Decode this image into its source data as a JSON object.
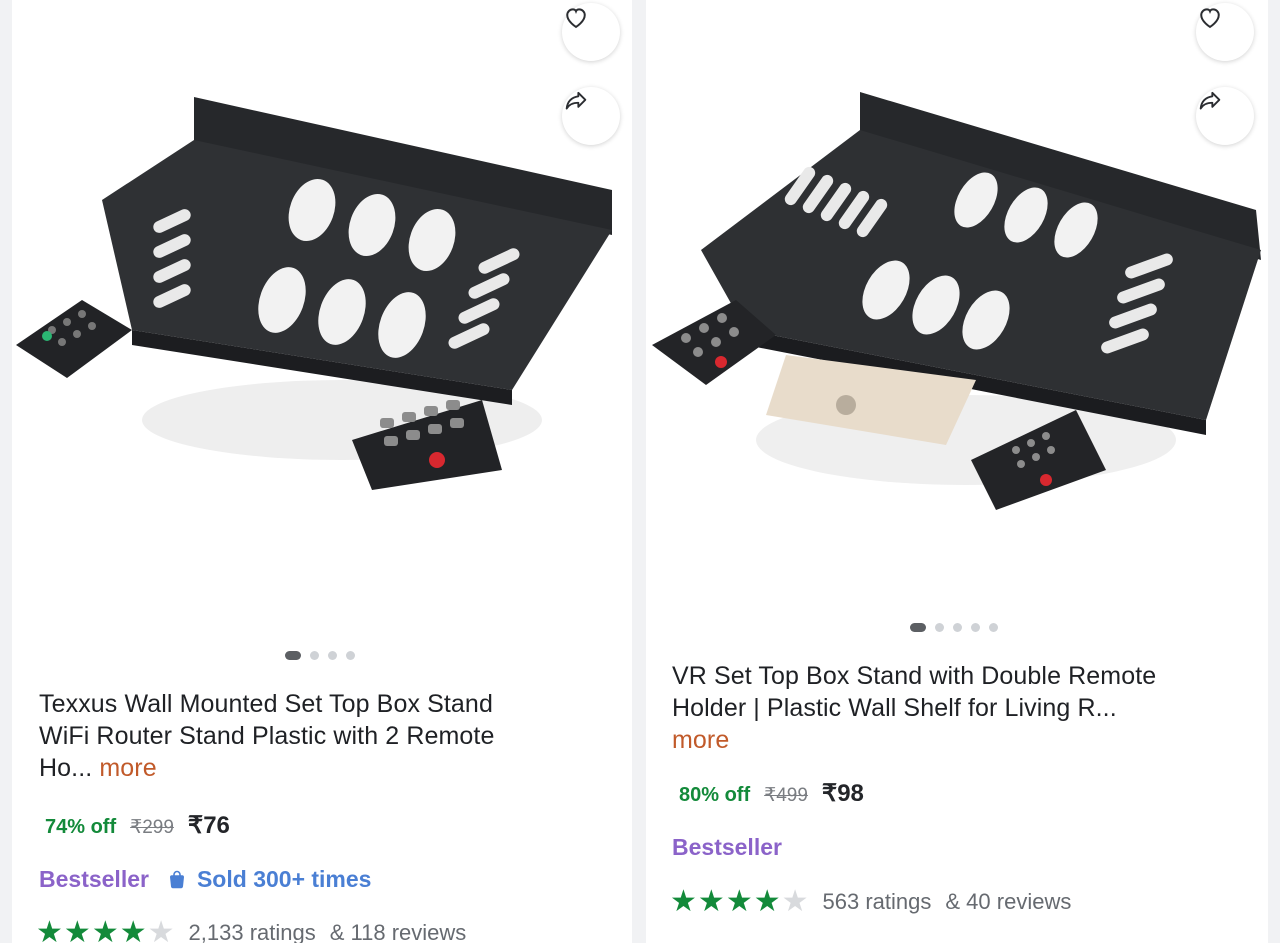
{
  "products": [
    {
      "title_line1": "Texxus Wall Mounted Set Top Box Stand",
      "title_line2": "WiFi Router Stand Plastic with 2 Remote",
      "title_line3": "Ho...",
      "more_label": "more",
      "discount": "74% off",
      "mrp": "₹299",
      "price": "₹76",
      "badge": "Bestseller",
      "sold": "Sold 300+ times",
      "rating_stars": 4,
      "ratings_text": "2,133 ratings",
      "reviews_text": "& 118 reviews",
      "image_count": 4,
      "active_image": 1
    },
    {
      "title_line1": "VR Set Top Box Stand with Double Remote",
      "title_line2": "Holder | Plastic Wall Shelf for Living R...",
      "more_label": "more",
      "discount": "80% off",
      "mrp": "₹499",
      "price": "₹98",
      "badge": "Bestseller",
      "rating_stars": 4,
      "ratings_text": "563 ratings",
      "reviews_text": "& 40 reviews",
      "image_count": 5,
      "active_image": 1
    }
  ],
  "icons": {
    "wishlist": "heart-icon",
    "share": "share-icon",
    "sold": "shopping-bag-icon",
    "rating": "star-icon"
  },
  "colors": {
    "discount": "#138a3a",
    "more_link": "#c15a2a",
    "bestseller": "#8b63c9",
    "sold": "#4a7fd4",
    "star": "#138a3a"
  }
}
